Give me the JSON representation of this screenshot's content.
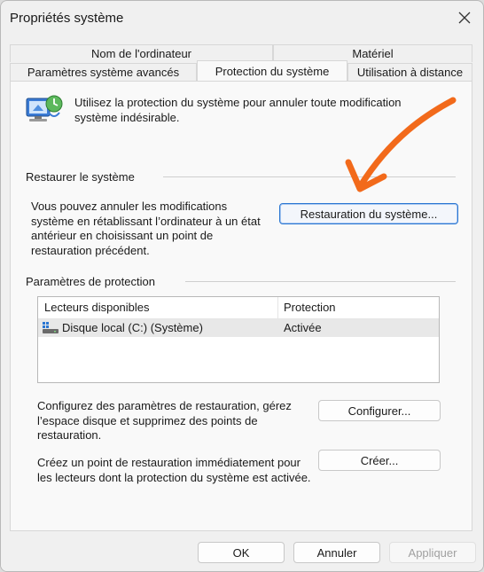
{
  "window": {
    "title": "Propriétés système"
  },
  "tabs": {
    "row_back": [
      "Nom de l'ordinateur",
      "Matériel"
    ],
    "row_front": [
      "Paramètres système avancés",
      "Protection du système",
      "Utilisation à distance"
    ],
    "active": "Protection du système"
  },
  "intro": {
    "text": "Utilisez la protection du système pour annuler toute modification système indésirable.",
    "icon": "computer-shield-icon"
  },
  "restore": {
    "group_label": "Restaurer le système",
    "description": "Vous pouvez annuler les modifications système en rétablissant l’ordinateur à un état antérieur en choisissant un point de restauration précédent.",
    "button_label": "Restauration du système..."
  },
  "protection": {
    "group_label": "Paramètres de protection",
    "columns": [
      "Lecteurs disponibles",
      "Protection"
    ],
    "rows": [
      {
        "drive": "Disque local (C:) (Système)",
        "status": "Activée",
        "icon": "drive-icon"
      }
    ],
    "configure_text": "Configurez des paramètres de restauration, gérez l’espace disque et supprimez des points de restauration.",
    "configure_button": "Configurer...",
    "create_text": "Créez un point de restauration immédiatement pour les lecteurs dont la protection du système est activée.",
    "create_button": "Créer..."
  },
  "footer": {
    "ok": "OK",
    "cancel": "Annuler",
    "apply": "Appliquer"
  },
  "colors": {
    "accent": "#2a76d2",
    "annotation_arrow": "#f26a1b",
    "window_bg": "#f0f0f0",
    "panel_bg": "#f9f9f9"
  }
}
